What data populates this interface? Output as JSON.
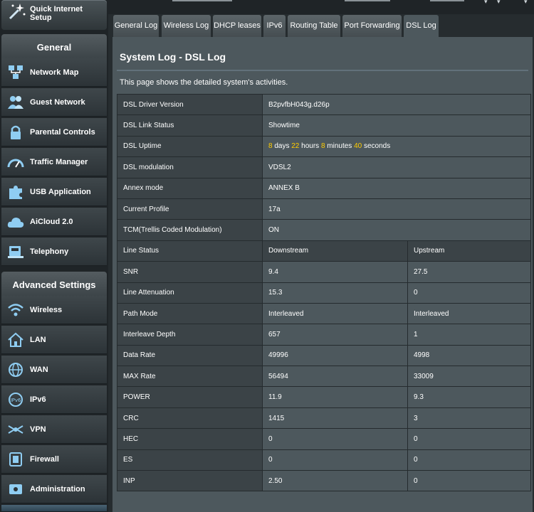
{
  "sidebar": {
    "quick_setup": "Quick Internet Setup",
    "general_title": "General",
    "general_items": [
      {
        "label": "Network Map",
        "icon": "network-map-icon"
      },
      {
        "label": "Guest Network",
        "icon": "guest-network-icon"
      },
      {
        "label": "Parental Controls",
        "icon": "parental-controls-icon"
      },
      {
        "label": "Traffic Manager",
        "icon": "traffic-manager-icon"
      },
      {
        "label": "USB Application",
        "icon": "usb-application-icon"
      },
      {
        "label": "AiCloud 2.0",
        "icon": "aicloud-icon"
      },
      {
        "label": "Telephony",
        "icon": "telephony-icon"
      }
    ],
    "advanced_title": "Advanced Settings",
    "advanced_items": [
      {
        "label": "Wireless",
        "icon": "wireless-icon"
      },
      {
        "label": "LAN",
        "icon": "lan-icon"
      },
      {
        "label": "WAN",
        "icon": "wan-icon"
      },
      {
        "label": "IPv6",
        "icon": "ipv6-icon"
      },
      {
        "label": "VPN",
        "icon": "vpn-icon"
      },
      {
        "label": "Firewall",
        "icon": "firewall-icon"
      },
      {
        "label": "Administration",
        "icon": "administration-icon"
      }
    ]
  },
  "tabs": [
    "General Log",
    "Wireless Log",
    "DHCP leases",
    "IPv6",
    "Routing Table",
    "Port Forwarding",
    "DSL Log"
  ],
  "active_tab": "DSL Log",
  "page": {
    "title": "System Log - DSL Log",
    "description": "This page shows the detailed system's activities."
  },
  "info_rows": [
    {
      "label": "DSL Driver Version",
      "value": "B2pvfbH043g.d26p"
    },
    {
      "label": "DSL Link Status",
      "value": "Showtime"
    },
    {
      "label": "DSL Uptime",
      "value": ""
    },
    {
      "label": "DSL modulation",
      "value": "VDSL2"
    },
    {
      "label": "Annex mode",
      "value": "ANNEX B"
    },
    {
      "label": "Current Profile",
      "value": "17a"
    },
    {
      "label": "TCM(Trellis Coded Modulation)",
      "value": "ON"
    }
  ],
  "uptime": {
    "days": "8",
    "days_label": "days",
    "hours": "22",
    "hours_label": "hours",
    "minutes": "8",
    "minutes_label": "minutes",
    "seconds": "40",
    "seconds_label": "seconds"
  },
  "line_status": {
    "header": {
      "label": "Line Status",
      "downstream": "Downstream",
      "upstream": "Upstream"
    },
    "rows": [
      {
        "label": "SNR",
        "down": "9.4",
        "up": "27.5"
      },
      {
        "label": "Line Attenuation",
        "down": "15.3",
        "up": "0"
      },
      {
        "label": "Path Mode",
        "down": "Interleaved",
        "up": "Interleaved"
      },
      {
        "label": "Interleave Depth",
        "down": "657",
        "up": "1"
      },
      {
        "label": "Data Rate",
        "down": "49996",
        "up": "4998"
      },
      {
        "label": "MAX Rate",
        "down": "56494",
        "up": "33009"
      },
      {
        "label": "POWER",
        "down": "11.9",
        "up": "9.3"
      },
      {
        "label": "CRC",
        "down": "1415",
        "up": "3"
      },
      {
        "label": "HEC",
        "down": "0",
        "up": "0"
      },
      {
        "label": "ES",
        "down": "0",
        "up": "0"
      },
      {
        "label": "INP",
        "down": "2.50",
        "up": "0"
      }
    ]
  },
  "colors": {
    "highlight_number": "#ffcc00",
    "panel": "#4d585d",
    "label_cell": "#3b4347",
    "sidebar": "#1f2427"
  }
}
